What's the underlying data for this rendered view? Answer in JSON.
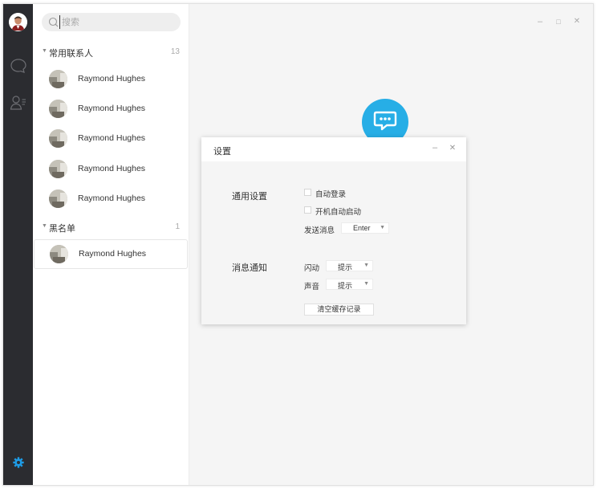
{
  "search": {
    "placeholder": "搜索"
  },
  "sidebar": {
    "rail": {
      "chat_icon": "chat-bubble-icon",
      "contacts_icon": "contacts-icon",
      "settings_icon": "gear-icon",
      "accent": "#1e9be4"
    }
  },
  "contacts": {
    "groups": [
      {
        "title": "常用联系人",
        "count": "13",
        "items": [
          "Raymond Hughes",
          "Raymond Hughes",
          "Raymond Hughes",
          "Raymond Hughes",
          "Raymond Hughes"
        ]
      },
      {
        "title": "黑名单",
        "count": "1",
        "items": [
          "Raymond Hughes"
        ]
      }
    ]
  },
  "window_controls": {
    "minimize": "–",
    "maximize": "□",
    "close": "✕"
  },
  "dialog": {
    "title": "设置",
    "minimize": "–",
    "close": "✕",
    "general": {
      "label": "通用设置",
      "auto_login": "自动登录",
      "auto_start": "开机自动启动",
      "send_label": "发送消息",
      "send_value": "Enter"
    },
    "notify": {
      "label": "消息通知",
      "flash_label": "闪动",
      "flash_value": "提示",
      "sound_label": "声音",
      "sound_value": "提示",
      "clear_button": "清空缓存记录"
    }
  },
  "colors": {
    "rail_bg": "#2b2c30",
    "brand": "#27aee6"
  }
}
